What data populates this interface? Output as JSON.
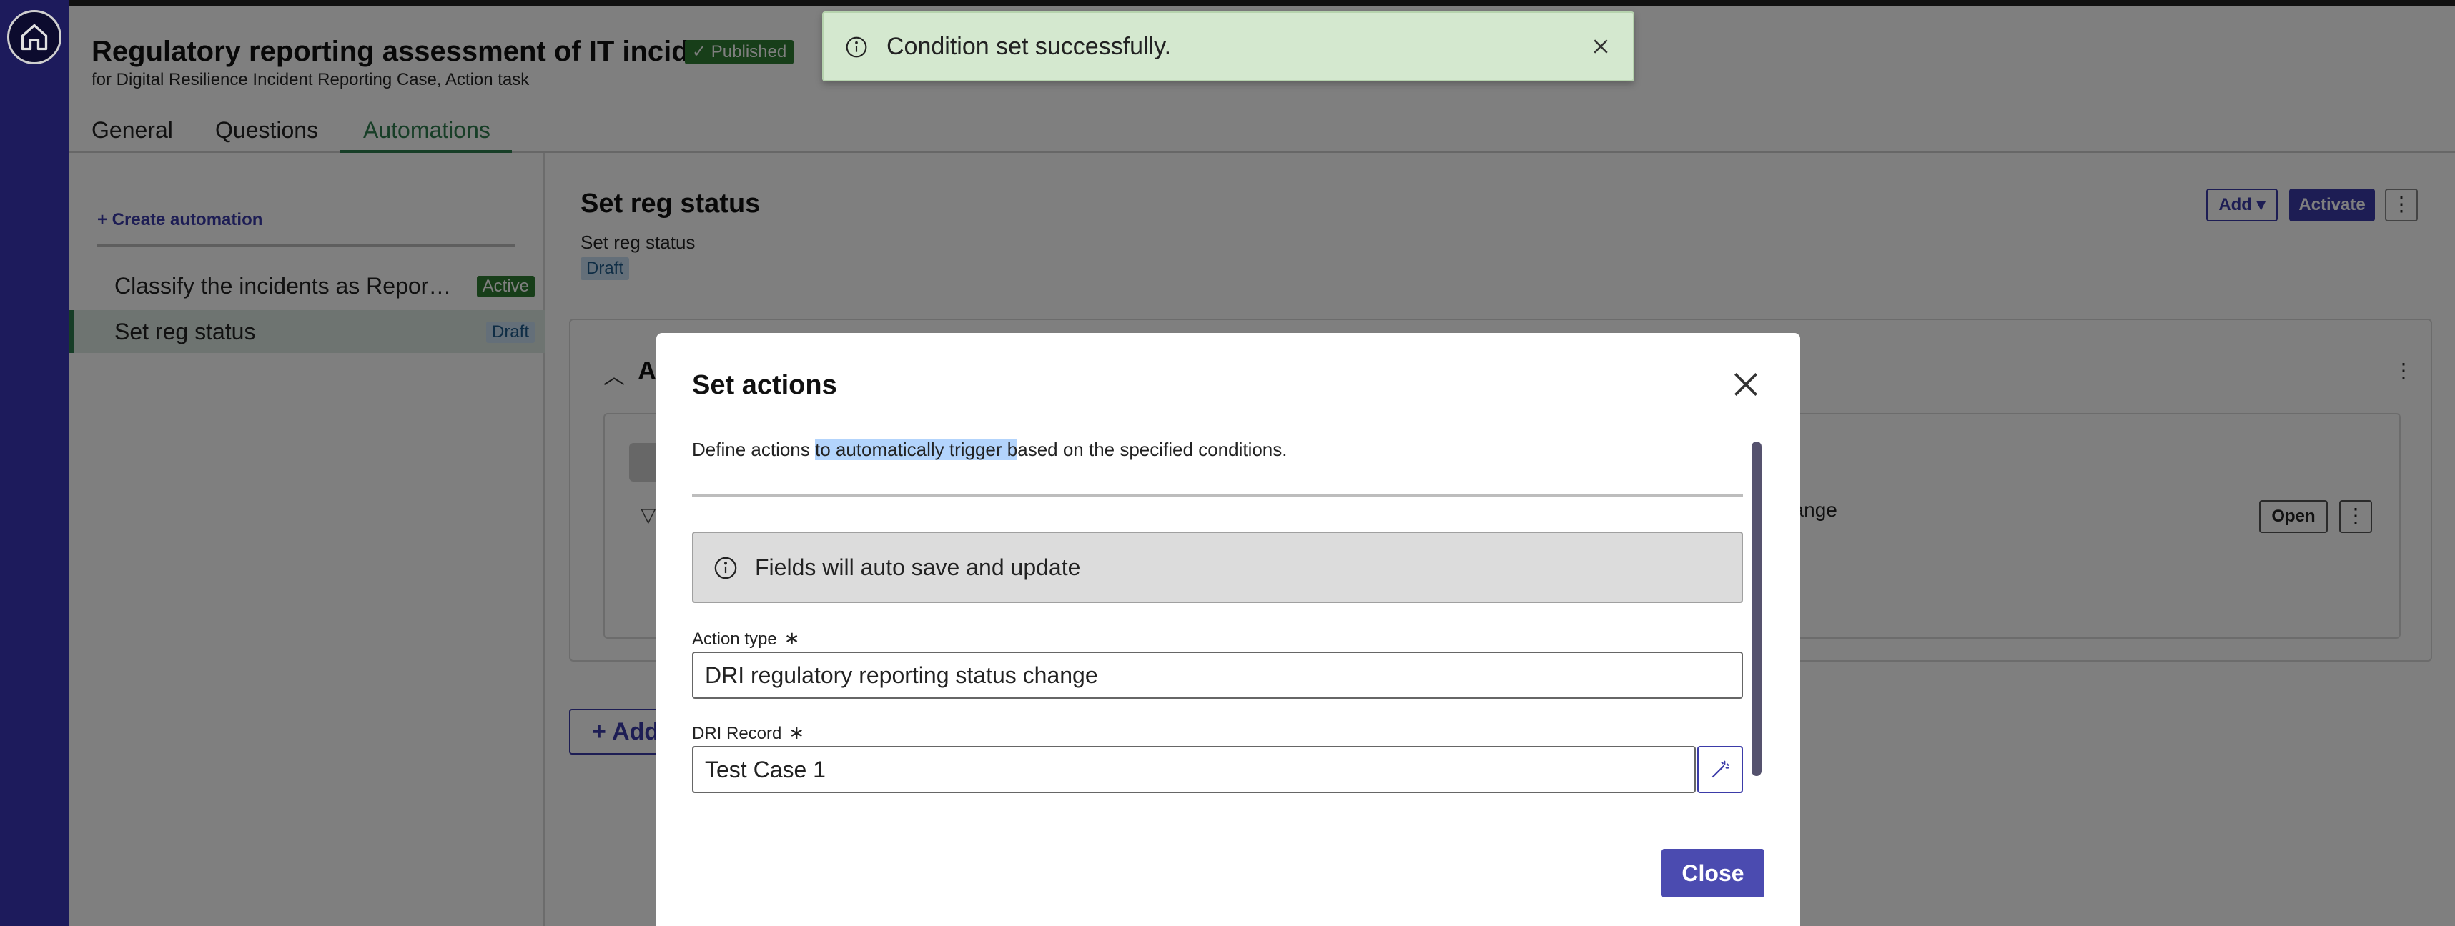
{
  "header": {
    "title": "Regulatory reporting assessment of IT incidents",
    "status_badge": "✓ Published",
    "subtitle": "for Digital Resilience Incident Reporting Case, Action task"
  },
  "tabs": [
    {
      "label": "General"
    },
    {
      "label": "Questions"
    },
    {
      "label": "Automations",
      "active": true
    }
  ],
  "sidebar": {
    "create_label": "+ Create automation",
    "items": [
      {
        "label": "Classify the incidents as Repor…",
        "badge": "Active"
      },
      {
        "label": "Set reg status",
        "badge": "Draft",
        "selected": true
      }
    ]
  },
  "detail": {
    "title": "Set reg status",
    "subtitle": "Set reg status",
    "badge": "Draft",
    "add_label": "Add ▾",
    "activate_label": "Activate",
    "section_title": "Ac",
    "card_text": "change",
    "open_label": "Open",
    "add_bottom_label": "+ Add"
  },
  "toast": {
    "message": "Condition set successfully."
  },
  "modal": {
    "title": "Set actions",
    "description_before": "Define actions ",
    "description_highlight": "to automatically trigger b",
    "description_after": "ased on the specified conditions.",
    "info": "Fields will auto save and update",
    "action_type": {
      "label": "Action type",
      "value": "DRI regulatory reporting status change"
    },
    "dri_record": {
      "label": "DRI Record",
      "value": "Test Case 1"
    },
    "required_mark": "∗",
    "close_label": "Close"
  },
  "colors": {
    "rail": "#1d1b5c",
    "accent": "#3b3ba8",
    "green": "#2e7d32",
    "toast_bg": "#d4e8cf",
    "draft_bg": "#c8dff2"
  },
  "icons": [
    "home-icon",
    "info-icon",
    "close-icon",
    "wand-icon",
    "kebab-icon",
    "chevron-up-icon",
    "filter-icon"
  ]
}
